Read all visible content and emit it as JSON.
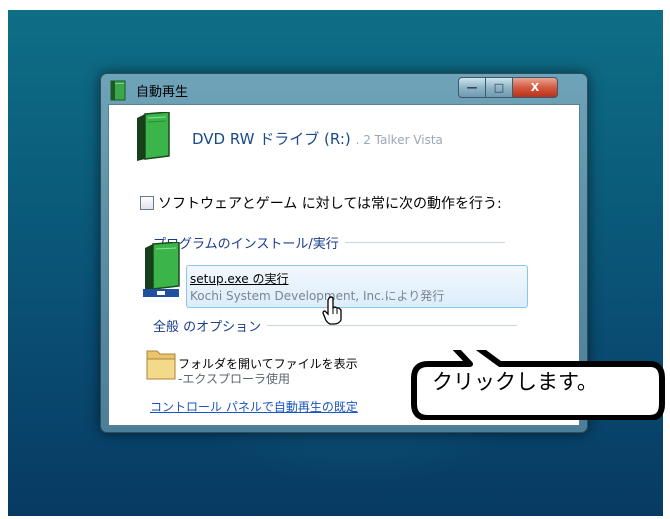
{
  "window": {
    "title": "自動再生",
    "controls": {
      "minimize": "—",
      "maximize": "□",
      "close": "X"
    }
  },
  "device": {
    "label": "DVD RW ドライブ (R:)",
    "faded_suffix": ". 2 Talker Vista"
  },
  "always_checkbox": {
    "label": "ソフトウェアとゲーム に対しては常に次の動作を行う:",
    "checked": false
  },
  "section_install": {
    "title": "プログラムのインストール/実行"
  },
  "install_option": {
    "main": "setup.exe の実行",
    "sub": "Kochi System Development, Inc.により発行"
  },
  "section_general": {
    "title": "全般 のオプション"
  },
  "folder_option": {
    "main": "フォルダを開いてファイルを表示",
    "sub": "-エクスプローラ使用"
  },
  "control_panel_link": "コントロール パネルで自動再生の既定",
  "callout": {
    "text": "クリックします。"
  },
  "icons": [
    "book-icon",
    "folder-icon",
    "hand-cursor-icon"
  ],
  "colors": {
    "accent": "#1a3b8c",
    "link": "#1a55c0",
    "highlight_border": "#8ec3ea"
  }
}
